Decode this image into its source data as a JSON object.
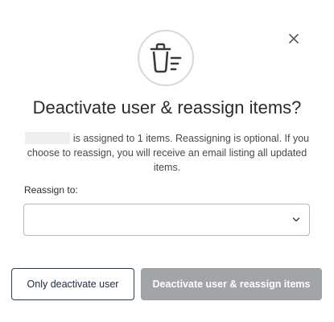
{
  "dialog": {
    "title": "Deactivate user & reassign items?",
    "message": "is assigned to 1 items. Reassigning is optional. If you choose to reassign, you will receive an email listing all updated items.",
    "reassign_label": "Reassign to:",
    "reassign_value": "",
    "buttons": {
      "only_deactivate": "Only deactivate user",
      "deactivate_and_reassign": "Deactivate user & reassign items"
    },
    "icons": {
      "header": "trash-icon",
      "close": "close-icon",
      "select_caret": "chevron-down-icon"
    },
    "colors": {
      "primary_button_disabled": "#a2a4a8",
      "secondary_button_border": "#2d3b55",
      "icon_circle_border": "#d8d8d8"
    }
  }
}
